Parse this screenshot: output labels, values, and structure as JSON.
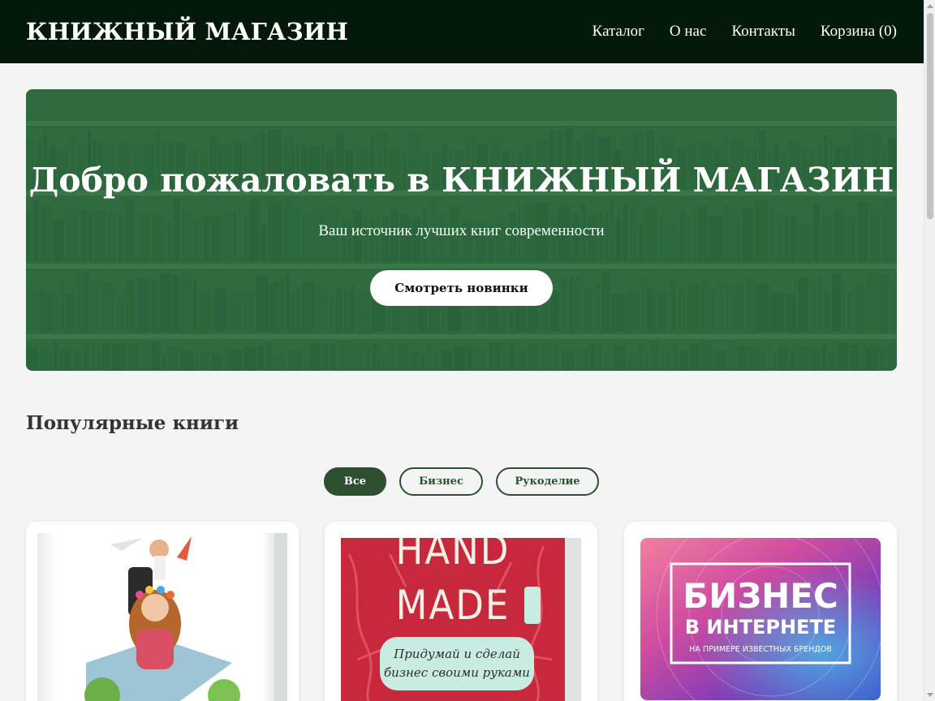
{
  "header": {
    "logo": "КНИЖНЫЙ МАГАЗИН",
    "nav": [
      "Каталог",
      "О нас",
      "Контакты",
      "Корзина (0)"
    ]
  },
  "hero": {
    "title": "Добро пожаловать в КНИЖНЫЙ МАГАЗИН",
    "subtitle": "Ваш источник лучших книг современности",
    "cta": "Смотреть новинки"
  },
  "section": {
    "title": "Популярные книги"
  },
  "filters": [
    {
      "label": "Все",
      "active": true
    },
    {
      "label": "Бизнес",
      "active": false
    },
    {
      "label": "Рукоделие",
      "active": false
    }
  ],
  "books": [
    {
      "cover_text": []
    },
    {
      "cover_text": [
        "HAND",
        "MADE",
        "Придумай и сделай",
        "бизнес своими руками"
      ]
    },
    {
      "cover_text": [
        "БИЗНЕС",
        "В ИНТЕРНЕТЕ",
        "НА ПРИМЕРЕ ИЗВЕСТНЫХ БРЕНДОВ"
      ]
    }
  ],
  "colors": {
    "header_bg": "#05190b",
    "hero_bg": "#2f6b3f",
    "accent": "#2d4f2f",
    "page_bg": "#f4f4f4"
  }
}
